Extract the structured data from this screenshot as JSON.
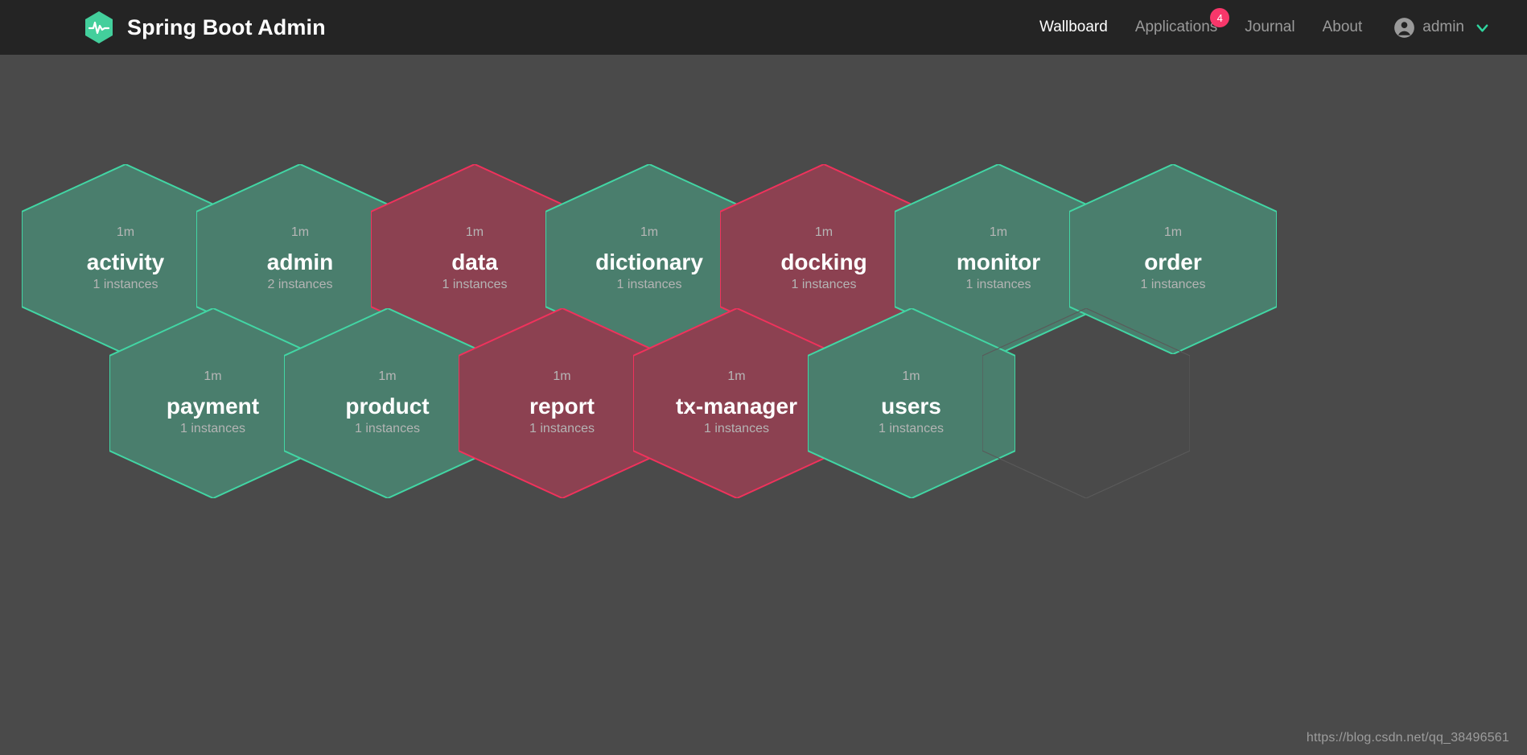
{
  "header": {
    "brand_title": "Spring Boot Admin",
    "logo_icon": "spring-boot-admin-hexagon-pulse-logo",
    "nav": [
      {
        "label": "Wallboard",
        "active": true,
        "badge": null
      },
      {
        "label": "Applications",
        "active": false,
        "badge": "4"
      },
      {
        "label": "Journal",
        "active": false,
        "badge": null
      },
      {
        "label": "About",
        "active": false,
        "badge": null
      }
    ],
    "user": {
      "name": "admin",
      "avatar_icon": "user-circle-icon",
      "chevron_icon": "chevron-down-icon"
    }
  },
  "wallboard": {
    "rows": [
      {
        "row_index": 0,
        "hexagons": [
          {
            "name": "activity",
            "uptime": "1m",
            "instances": "1 instances",
            "status": "up"
          },
          {
            "name": "admin",
            "uptime": "1m",
            "instances": "2 instances",
            "status": "up"
          },
          {
            "name": "data",
            "uptime": "1m",
            "instances": "1 instances",
            "status": "down"
          },
          {
            "name": "dictionary",
            "uptime": "1m",
            "instances": "1 instances",
            "status": "up"
          },
          {
            "name": "docking",
            "uptime": "1m",
            "instances": "1 instances",
            "status": "down"
          },
          {
            "name": "monitor",
            "uptime": "1m",
            "instances": "1 instances",
            "status": "up"
          },
          {
            "name": "order",
            "uptime": "1m",
            "instances": "1 instances",
            "status": "up"
          }
        ]
      },
      {
        "row_index": 1,
        "hexagons": [
          {
            "name": "payment",
            "uptime": "1m",
            "instances": "1 instances",
            "status": "up"
          },
          {
            "name": "product",
            "uptime": "1m",
            "instances": "1 instances",
            "status": "up"
          },
          {
            "name": "report",
            "uptime": "1m",
            "instances": "1 instances",
            "status": "down"
          },
          {
            "name": "tx-manager",
            "uptime": "1m",
            "instances": "1 instances",
            "status": "down"
          },
          {
            "name": "users",
            "uptime": "1m",
            "instances": "1 instances",
            "status": "up"
          },
          {
            "name": "",
            "uptime": "",
            "instances": "",
            "status": "empty"
          }
        ]
      }
    ]
  },
  "watermark": "https://blog.csdn.net/qq_38496561",
  "colors": {
    "page_background": "#4a4a4a",
    "header_background": "#242424",
    "accent_green": "#48c9a0",
    "status_up_border": "#42d6a4",
    "status_up_fill": "#4a7e6d",
    "status_down_border": "#f0325c",
    "status_down_fill": "#8c4151",
    "status_empty_border": "#5a5a5a",
    "badge_background": "#f8376a",
    "text_primary": "#ffffff",
    "text_muted": "#9a9a9a"
  }
}
